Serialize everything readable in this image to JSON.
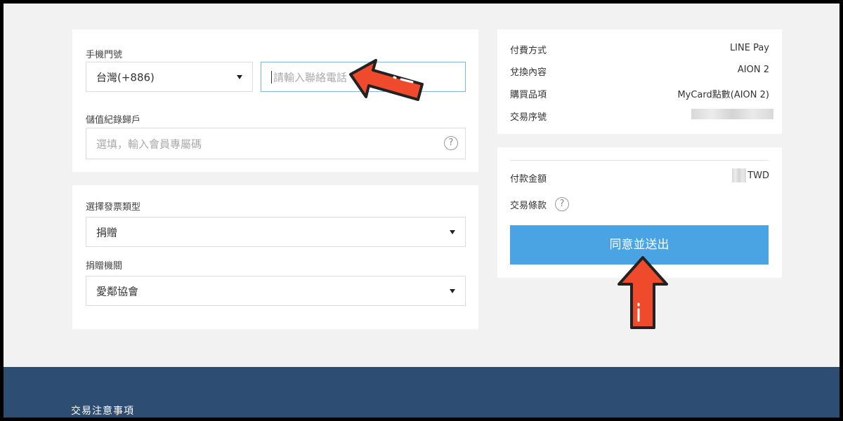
{
  "phone_section": {
    "label": "手機門號",
    "country_select": "台灣(+886)",
    "phone_placeholder": "請輸入聯絡電話"
  },
  "record_section": {
    "label": "儲值紀錄歸戶",
    "member_placeholder": "選填，輸入會員專屬碼",
    "help_icon": "?"
  },
  "invoice_section": {
    "type_label": "選擇發票類型",
    "type_value": "捐贈",
    "org_label": "捐贈機關",
    "org_value": "愛鄰協會"
  },
  "order_info": {
    "rows": [
      {
        "label": "付費方式",
        "value": "LINE Pay"
      },
      {
        "label": "兌換內容",
        "value": "AION 2"
      },
      {
        "label": "購買品項",
        "value": "MyCard點數(AION 2)"
      },
      {
        "label": "交易序號",
        "value": ""
      }
    ]
  },
  "payment": {
    "amount_label": "付款金額",
    "currency": "TWD",
    "terms_label": "交易條款",
    "terms_help_icon": "?",
    "submit_label": "同意並送出"
  },
  "footer": {
    "title": "交易注意事項"
  },
  "colors": {
    "accent_button": "#4aa3e2",
    "footer_bg": "#2d4e72",
    "annotation_arrow": "#f04a2c",
    "focus_border": "#7fb6e0"
  },
  "icons": [
    "chevron-down-icon",
    "help-icon",
    "arrow-pointer-icon"
  ]
}
